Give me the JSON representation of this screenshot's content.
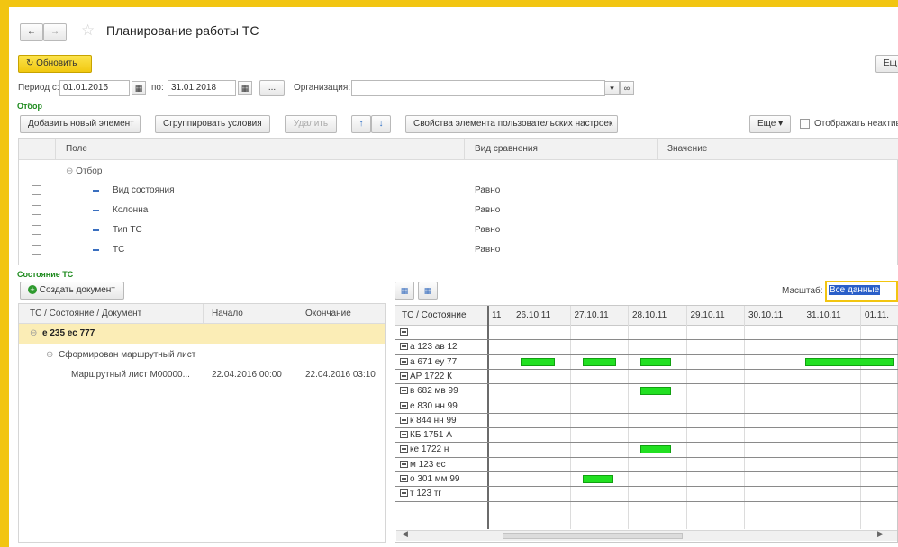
{
  "window": {
    "title": "Планирование работы ТС"
  },
  "toolbar": {
    "refresh_label": "Обновить",
    "more_label": "Ещ"
  },
  "period": {
    "from_label": "Период с:",
    "from_value": "01.01.2015",
    "to_label": "по:",
    "to_value": "31.01.2018",
    "dots_label": "...",
    "org_label": "Организация:",
    "org_value": ""
  },
  "filter": {
    "section_label": "Отбор",
    "add_label": "Добавить новый элемент",
    "group_label": "Сгруппировать условия",
    "delete_label": "Удалить",
    "props_label": "Свойства элемента пользовательских настроек",
    "more_label": "Еще",
    "show_inactive_label": "Отображать неактив",
    "columns": {
      "field": "Поле",
      "comparison": "Вид сравнения",
      "value": "Значение"
    },
    "group_row": "Отбор",
    "rows": [
      {
        "field": "Вид состояния",
        "comparison": "Равно"
      },
      {
        "field": "Колонна",
        "comparison": "Равно"
      },
      {
        "field": "Тип ТС",
        "comparison": "Равно"
      },
      {
        "field": "ТС",
        "comparison": "Равно"
      }
    ]
  },
  "state": {
    "section_label": "Состояние ТС",
    "create_doc_label": "Создать документ",
    "columns": {
      "doc": "ТС / Состояние / Документ",
      "start": "Начало",
      "end": "Окончание"
    },
    "tree": {
      "vehicle": "е 235 ес 777",
      "status": "Сформирован маршрутный лист",
      "doc": "Маршрутный лист М00000...",
      "doc_start": "22.04.2016 00:00",
      "doc_end": "22.04.2016 03:10"
    }
  },
  "gantt": {
    "scale_label": "Масштаб:",
    "scale_value": "Все данные",
    "header": "ТС / Состояние",
    "partial_date": "11",
    "dates": [
      "26.10.11",
      "27.10.11",
      "28.10.11",
      "29.10.11",
      "30.10.11",
      "31.10.11",
      "01.11."
    ],
    "rows": [
      {
        "label": "",
        "bars": []
      },
      {
        "label": "а 123 ав 12",
        "bars": []
      },
      {
        "label": "а 671 еу 77",
        "bars": [
          [
            0.15,
            0.75
          ],
          [
            1.22,
            1.8
          ],
          [
            2.22,
            2.75
          ],
          [
            5.05,
            6.65
          ]
        ]
      },
      {
        "label": "АР 1722 К",
        "bars": []
      },
      {
        "label": "в 682 мв 99",
        "bars": [
          [
            2.22,
            2.75
          ]
        ]
      },
      {
        "label": "е 830 нн 99",
        "bars": []
      },
      {
        "label": "к 844 нн 99",
        "bars": []
      },
      {
        "label": "КБ 1751 А",
        "bars": []
      },
      {
        "label": "ке 1722 н",
        "bars": [
          [
            2.22,
            2.75
          ]
        ]
      },
      {
        "label": "м 123 ес",
        "bars": []
      },
      {
        "label": "о 301 мм 99",
        "bars": [
          [
            1.22,
            1.75
          ]
        ]
      },
      {
        "label": "т 123 тг",
        "bars": []
      }
    ]
  }
}
